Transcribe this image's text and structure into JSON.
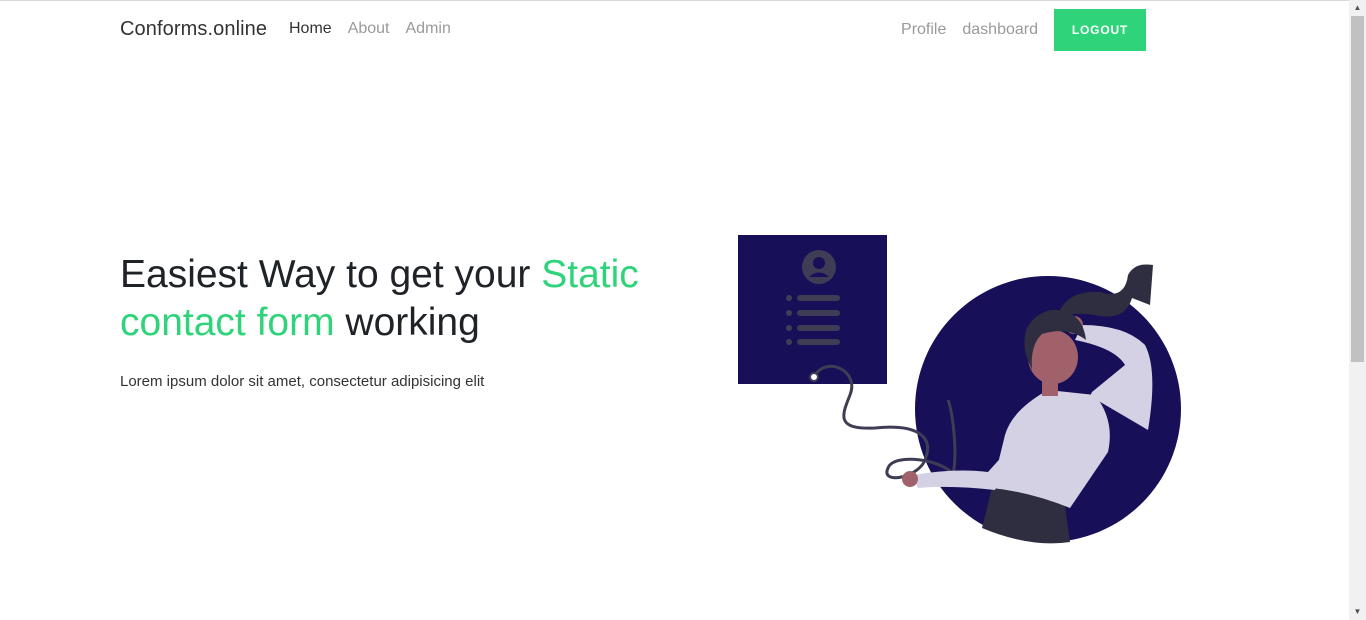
{
  "brand": "Conforms.online",
  "nav": {
    "home": "Home",
    "about": "About",
    "admin": "Admin",
    "profile": "Profile",
    "dashboard": "dashboard",
    "logout": "LOGOUT"
  },
  "hero": {
    "title_part1": "Easiest Way to get your ",
    "title_accent": "Static contact form",
    "title_part2": " working",
    "subtitle": "Lorem ipsum dolor sit amet, consectetur adipisicing elit"
  },
  "colors": {
    "accent": "#2fd47a",
    "navy": "#170f57",
    "text": "#1f2327"
  },
  "icons": {
    "scroll_up": "▲",
    "scroll_down": "▼"
  }
}
